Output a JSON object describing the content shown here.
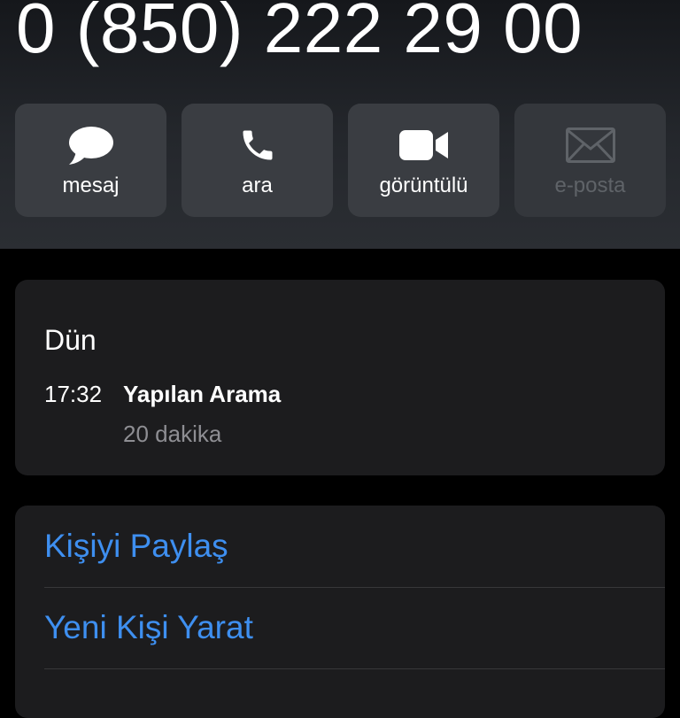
{
  "contact": {
    "phone_number": "0 (850) 222 29 00"
  },
  "actions": [
    {
      "label": "mesaj",
      "icon": "message-bubble-icon",
      "enabled": true
    },
    {
      "label": "ara",
      "icon": "phone-icon",
      "enabled": true
    },
    {
      "label": "görüntülü",
      "icon": "video-camera-icon",
      "enabled": true
    },
    {
      "label": "e-posta",
      "icon": "envelope-icon",
      "enabled": false
    }
  ],
  "call_history": {
    "day": "Dün",
    "time": "17:32",
    "type": "Yapılan Arama",
    "duration": "20 dakika"
  },
  "options": {
    "share_contact": "Kişiyi Paylaş",
    "create_contact": "Yeni Kişi Yarat"
  },
  "colors": {
    "accent": "#3e8ff0",
    "card_bg": "#1c1c1e",
    "secondary_text": "#8e8e93",
    "disabled_text": "#5f6368"
  }
}
